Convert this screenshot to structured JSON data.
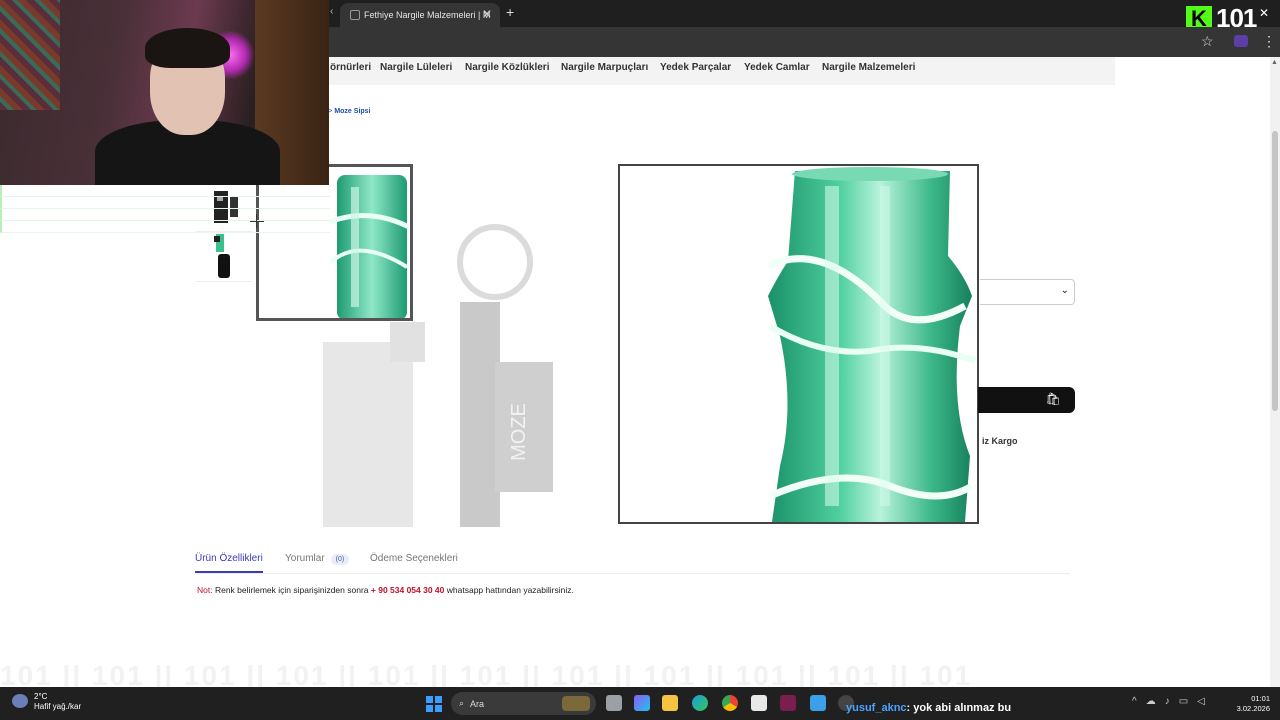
{
  "browser": {
    "tab_title": "Fethiye Nargile Malzemeleri | M",
    "tab_close": "✕",
    "new_tab": "+",
    "tab_nav": "‹",
    "kick_logo": "K",
    "kick_viewers": "101",
    "window_close": "✕",
    "star": "☆",
    "kebab": "⋮"
  },
  "site": {
    "nav": [
      "örnürleri",
      "Nargile Lüleleri",
      "Nargile Közlükleri",
      "Nargile Marpuçları",
      "Yedek Parçalar",
      "Yedek Camlar",
      "Nargile Malzemeleri"
    ],
    "breadcrumb_sep": "r >",
    "breadcrumb_current": "Moze Sipsi",
    "background_brand": "MOZE",
    "select_chevron": "⌄",
    "cart_icon": "🛍",
    "cargo_text": "iz Kargo",
    "tabs": {
      "features": "Ürün Özellikleri",
      "reviews": "Yorumlar",
      "reviews_count": "(0)",
      "payment": "Ödeme Seçenekleri"
    },
    "note": {
      "label": "Not:",
      "text_before": "Renk belirlemek için siparişinizden sonra",
      "phone": "+ 90 534 054 30 40",
      "text_after": "whatsapp hattından yazabilirsiniz."
    },
    "watermark": "101 || 101 || 101 || 101 || 101 || 101 || 101 || 101 || 101 || 101 || 101"
  },
  "taskbar": {
    "temperature": "2°C",
    "weather": "Hafif yağ./kar",
    "search_placeholder": "Ara",
    "chat_user": "yusuf_aknc",
    "chat_message": ": yok abi alınmaz bu",
    "tray_caret": "^",
    "time": "01:01",
    "date": "3.02.2026"
  },
  "colors": {
    "accent_green": "#53fc18",
    "tab_active": "#3b3bb8",
    "note_red": "#c0112a",
    "product_green": "#2fb38a"
  }
}
